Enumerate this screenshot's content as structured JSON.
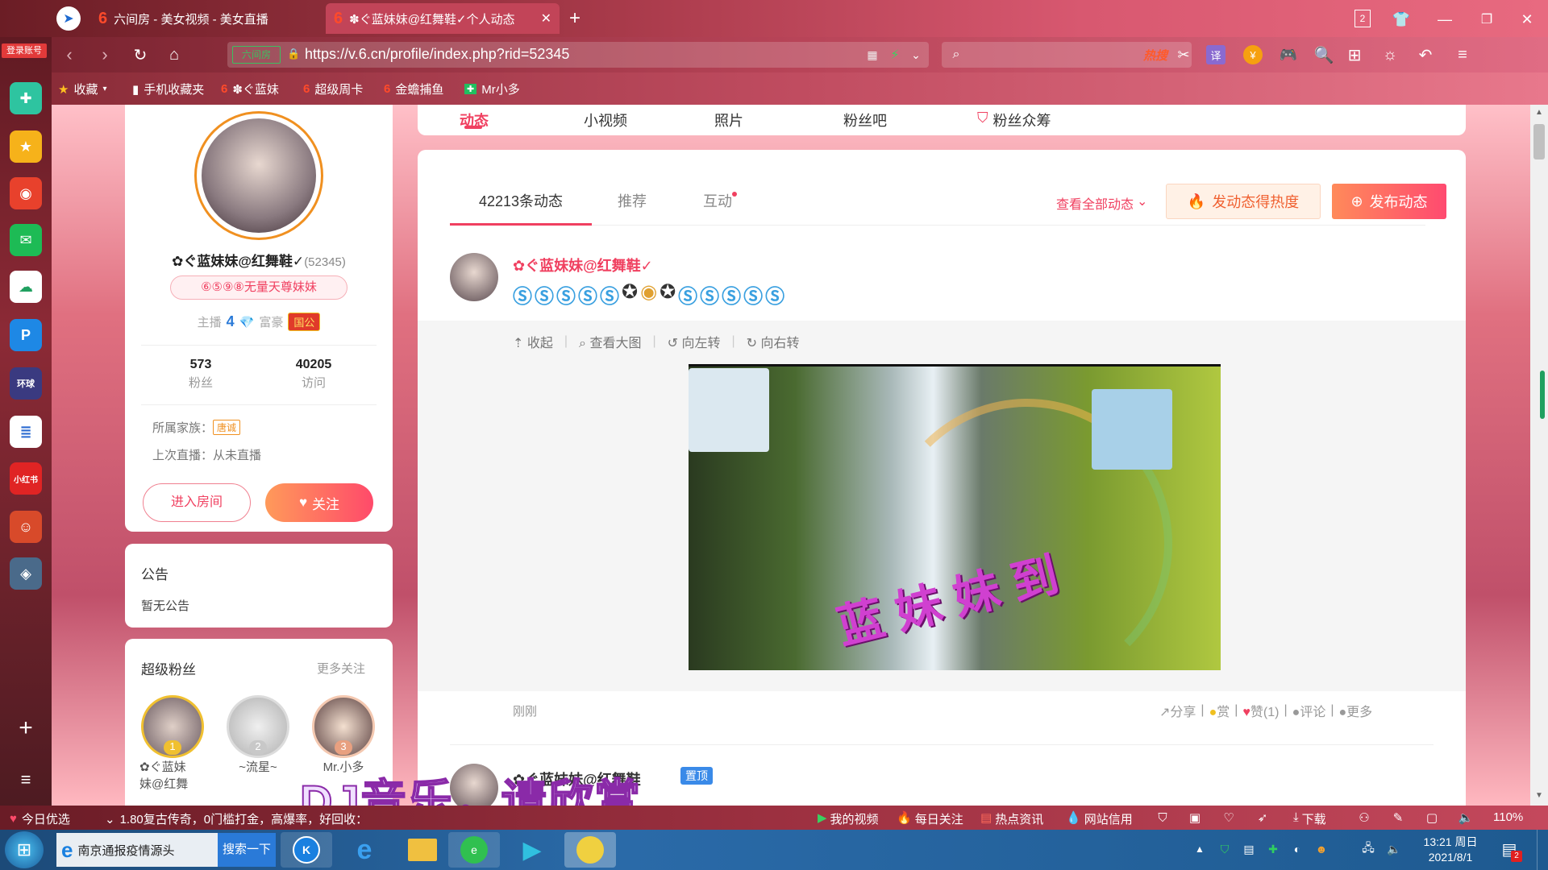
{
  "browser": {
    "rail_badge": "登录账号",
    "tabs": [
      {
        "label": "六间房 - 美女视频 - 美女直播"
      },
      {
        "label": "✽ぐ蓝妹妹@红舞鞋✓个人动态"
      }
    ],
    "tab_count": "2",
    "url_domain_badge": "六间房",
    "url": "https://v.6.cn/profile/index.php?rid=52345",
    "search_hot": "热搜",
    "bookmarks": [
      "收藏",
      "手机收藏夹",
      "✽ぐ蓝妹",
      "超级周卡",
      "金蟾捕鱼",
      "Mr小多"
    ]
  },
  "profile": {
    "nav_tabs": [
      "动态",
      "小视频",
      "照片",
      "粉丝吧",
      "粉丝众筹"
    ],
    "name": "✿ぐ蓝妹妹@红舞鞋✓",
    "rid": "(52345)",
    "pill": "⑥⑤⑨⑧无量天尊妹妹",
    "anchor_label": "主播",
    "anchor_level": "4",
    "rich_label": "富豪",
    "rich_badge": "国公",
    "fans_count": "573",
    "fans_label": "粉丝",
    "visits_count": "40205",
    "visits_label": "访问",
    "family_label": "所属家族：",
    "family_badge": "唐诚",
    "last_live": "上次直播：从未直播",
    "enter_room": "进入房间",
    "follow": "关注"
  },
  "notice": {
    "title": "公告",
    "text": "暂无公告"
  },
  "super_fans": {
    "title": "超级粉丝",
    "more": "更多关注",
    "fans": [
      {
        "rank": "1",
        "name": "✿ぐ蓝妹\n妹@红舞"
      },
      {
        "rank": "2",
        "name": "~流星~"
      },
      {
        "rank": "3",
        "name": "Mr.小多"
      }
    ]
  },
  "feed": {
    "tabs": [
      "42213条动态",
      "推荐",
      "互动"
    ],
    "view_all": "查看全部动态",
    "hot_button": "发动态得热度",
    "publish_button": "发布动态",
    "post": {
      "author": "✿ぐ蓝妹妹@红舞鞋✓",
      "actions": [
        "收起",
        "查看大图",
        "向左转",
        "向右转"
      ],
      "image_caption": "蓝 妹 妹 到",
      "time": "刚刚",
      "share": "分享",
      "reward": "赏",
      "like": "赞(1)",
      "comment": "评论",
      "more": "更多"
    },
    "next_post": {
      "author": "✿ぐ蓝妹妹@红舞鞋",
      "pin": "置顶"
    }
  },
  "overlay_text": "DJ音乐，请欣赏",
  "statusbar": {
    "left1": "今日优选",
    "ticker": "1.80复古传奇，0门槛打金，高爆率，好回收：",
    "items": [
      "我的视频",
      "每日关注",
      "热点资讯",
      "网站信用",
      "下载"
    ],
    "zoom": "110%"
  },
  "taskbar": {
    "ie_task": "南京通报疫情源头",
    "search_btn": "搜索一下",
    "time": "13:21 周日",
    "date": "2021/8/1"
  }
}
